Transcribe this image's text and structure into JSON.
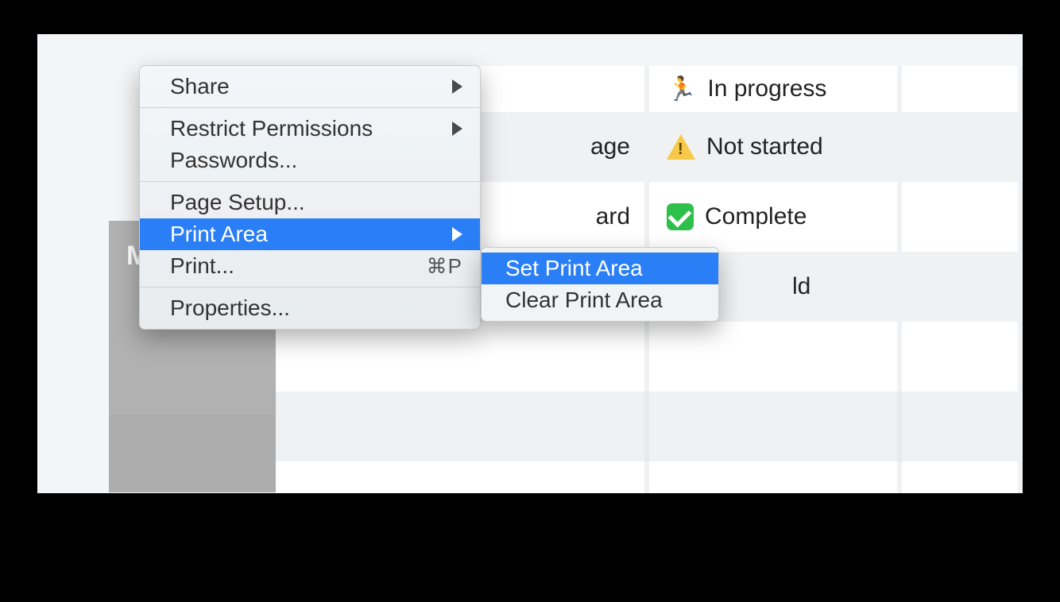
{
  "row_header_fragment": "Mor",
  "grid": {
    "r1_c2_fragment": "",
    "r1_c3_text": "In progress",
    "r2_c2_fragment": "age",
    "r2_c3_text": "Not started",
    "r3_c2_fragment": "ard",
    "r3_c3_text": "Complete",
    "r4_c3_fragment": "ld"
  },
  "menu": {
    "share": "Share",
    "restrict": "Restrict Permissions",
    "passwords": "Passwords...",
    "page_setup": "Page Setup...",
    "print_area": "Print Area",
    "print": "Print...",
    "print_shortcut": "⌘P",
    "properties": "Properties..."
  },
  "submenu": {
    "set": "Set Print Area",
    "clear": "Clear Print Area"
  }
}
